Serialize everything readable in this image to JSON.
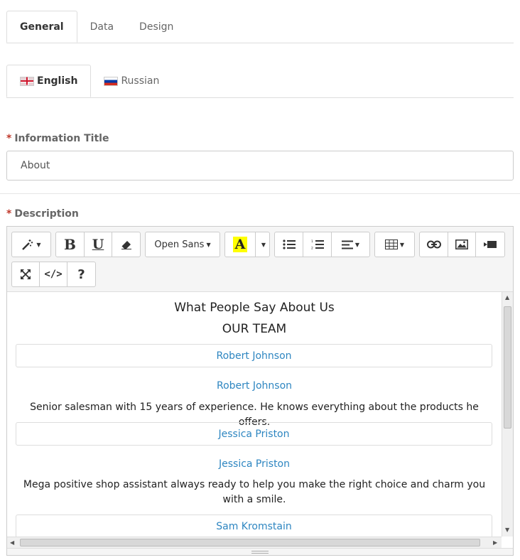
{
  "tabs": [
    {
      "label": "General",
      "active": true
    },
    {
      "label": "Data",
      "active": false
    },
    {
      "label": "Design",
      "active": false
    }
  ],
  "languages": [
    {
      "label": "English",
      "flag": "uk-flag-icon",
      "active": true
    },
    {
      "label": "Russian",
      "flag": "russia-flag-icon",
      "active": false
    }
  ],
  "form": {
    "required_mark": "*",
    "title_label": "Information Title",
    "title_value": "About",
    "description_label": "Description"
  },
  "toolbar": {
    "font_name": "Open Sans",
    "highlight_color": "#ffff00"
  },
  "content": {
    "heading": "What People Say About Us",
    "subheading": "OUR TEAM",
    "members": [
      {
        "name": "Robert Johnson",
        "description": "Senior salesman with 15 years of experience. He knows everything about the products he offers."
      },
      {
        "name": "Jessica Priston",
        "description": "Mega positive shop assistant always ready to help you make the right choice and charm you with a smile."
      },
      {
        "name": "Sam Kromstain"
      }
    ]
  },
  "colors": {
    "link": "#2e86c1",
    "required": "#c0392b"
  }
}
